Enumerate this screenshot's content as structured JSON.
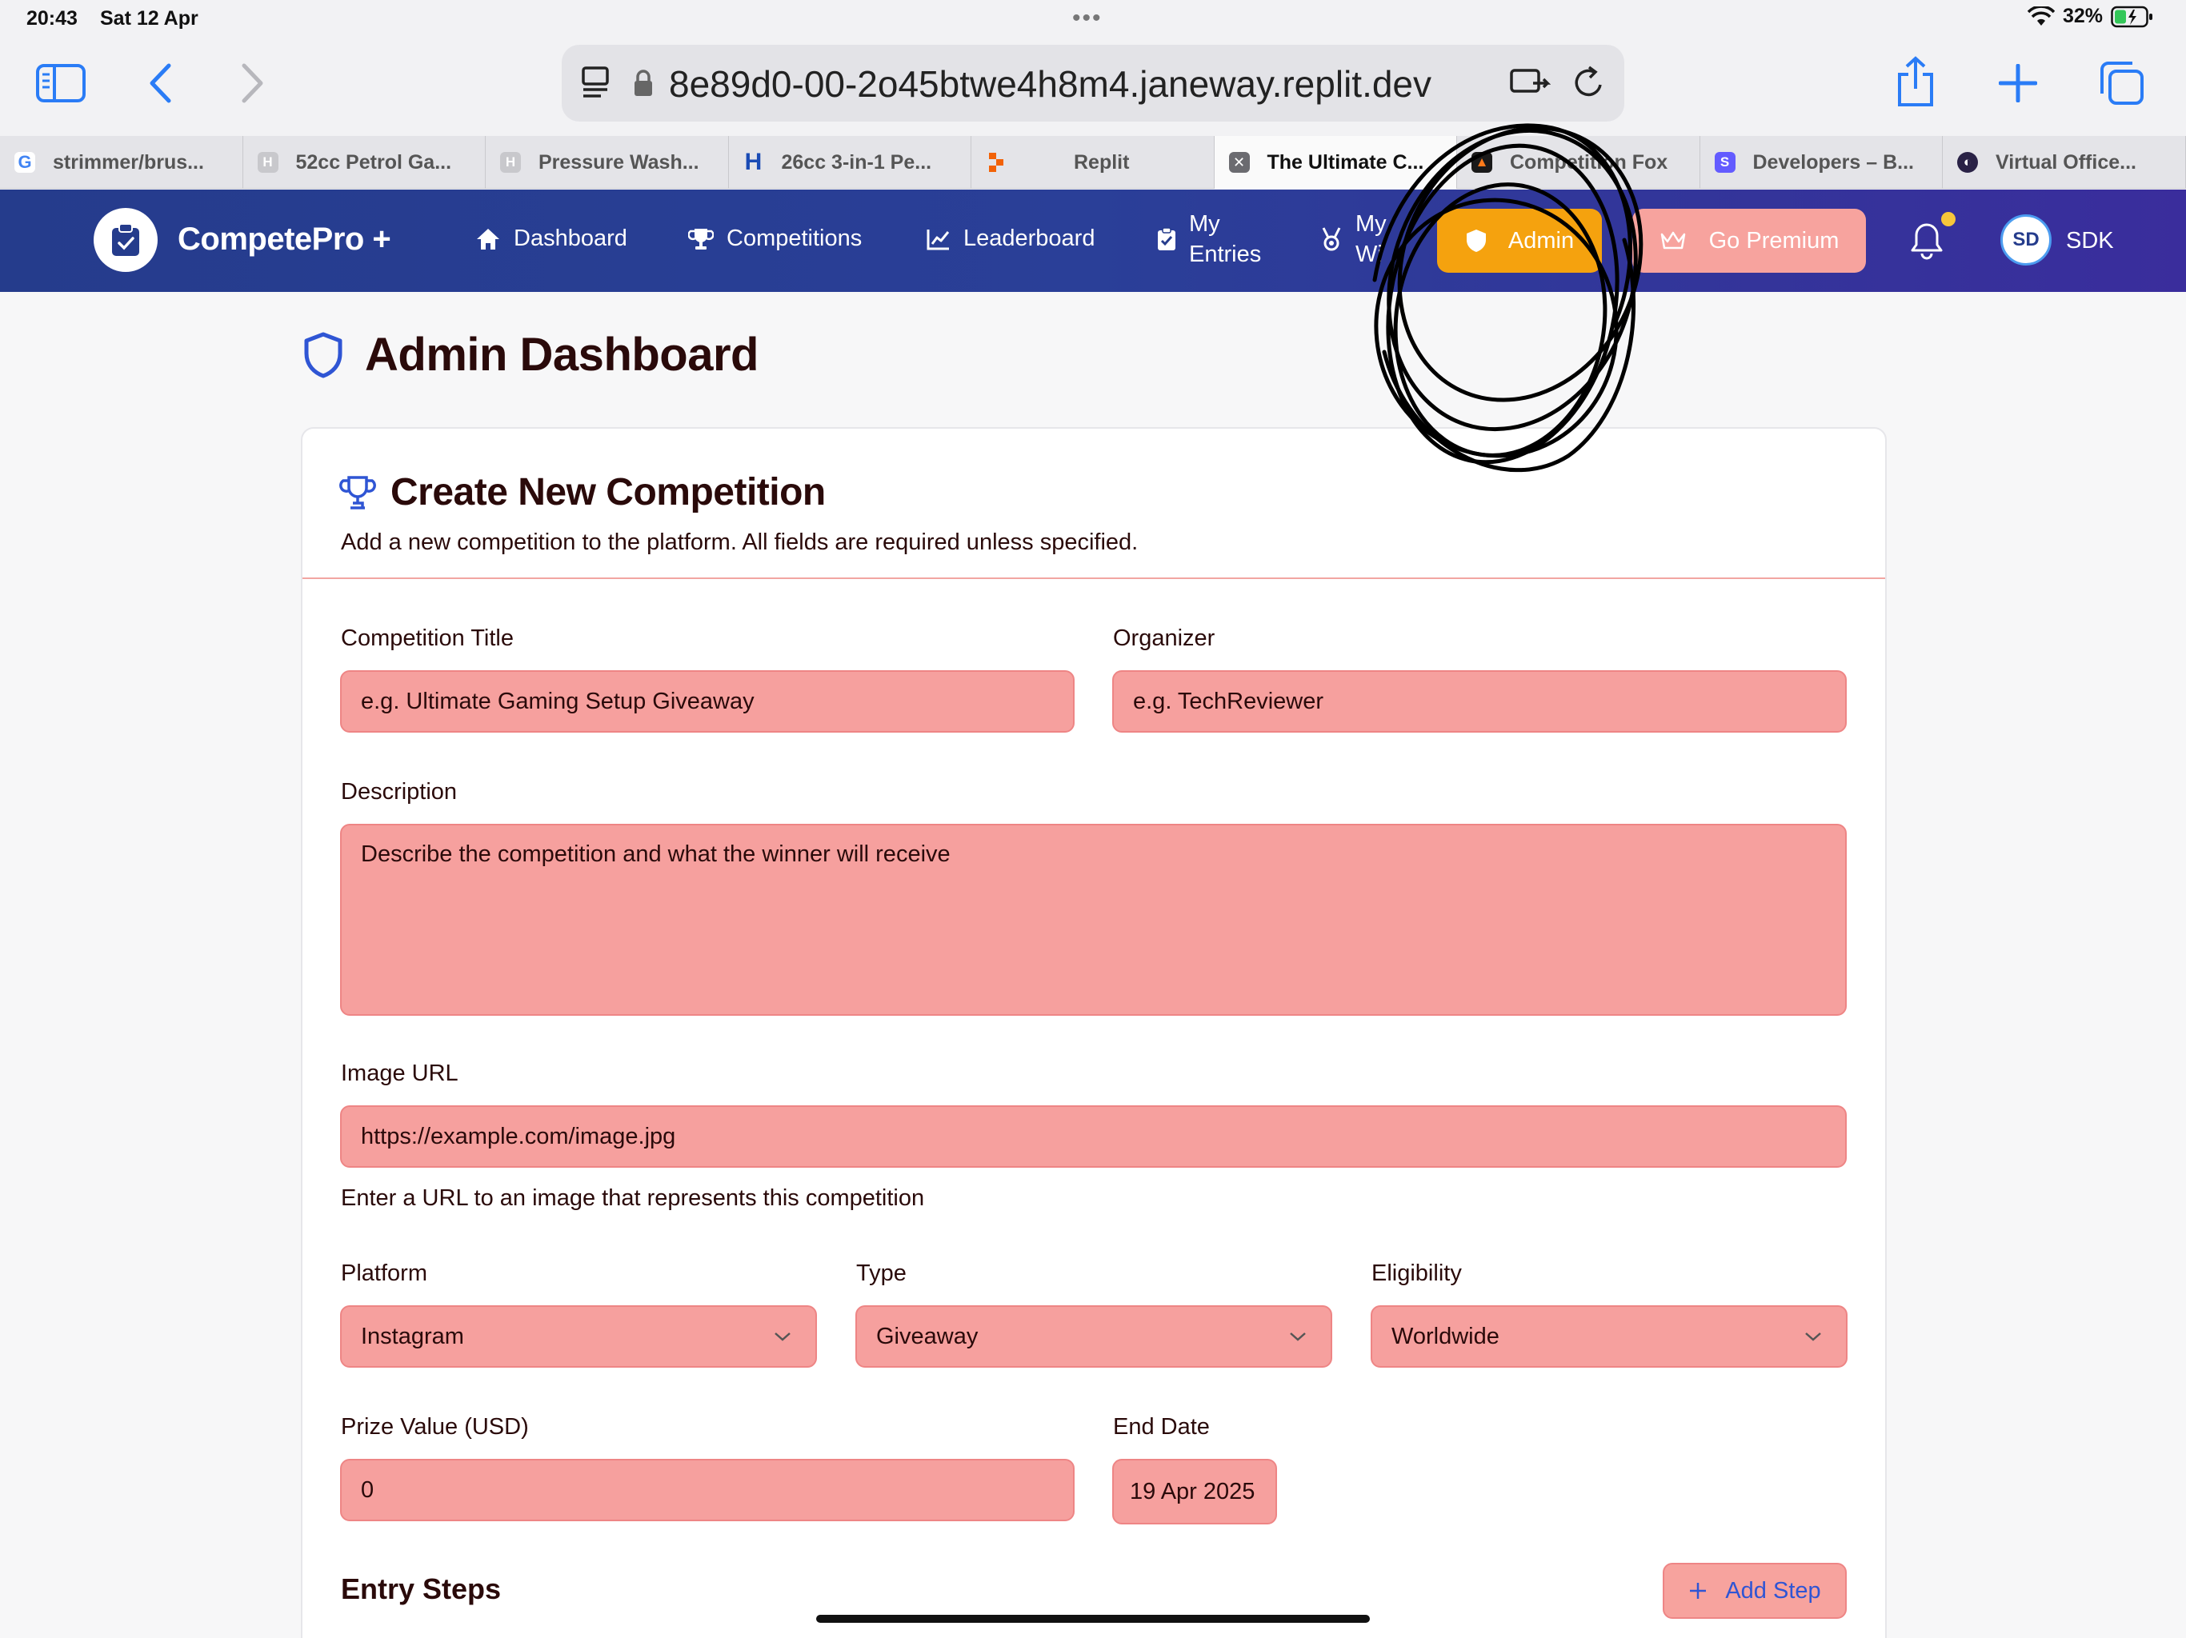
{
  "status_bar": {
    "time": "20:43",
    "date": "Sat 12 Apr",
    "battery": "32%"
  },
  "browser": {
    "url": "8e89d0-00-2o45btwe4h8m4.janeway.replit.dev",
    "tabs": [
      {
        "label": "strimmer/brus...",
        "favicon": "google-icon",
        "active": false
      },
      {
        "label": "52cc Petrol Ga...",
        "favicon": "h-icon",
        "active": false
      },
      {
        "label": "Pressure Wash...",
        "favicon": "h-icon",
        "active": false
      },
      {
        "label": "26cc 3-in-1 Pe...",
        "favicon": "h-brand-icon",
        "active": false
      },
      {
        "label": "Replit",
        "favicon": "replit-icon",
        "active": false
      },
      {
        "label": "The Ultimate C...",
        "favicon": "close-tab-icon",
        "active": true
      },
      {
        "label": "Competition Fox",
        "favicon": "fox-icon",
        "active": false
      },
      {
        "label": "Developers – B...",
        "favicon": "s-icon",
        "active": false
      },
      {
        "label": "Virtual Office...",
        "favicon": "virtual-office-icon",
        "active": false
      }
    ]
  },
  "app_nav": {
    "brand": "CompetePro +",
    "items": [
      {
        "label": "Dashboard",
        "icon": "home-icon"
      },
      {
        "label": "Competitions",
        "icon": "trophy-icon"
      },
      {
        "label": "Leaderboard",
        "icon": "chart-line-icon"
      },
      {
        "label": "My Entries",
        "line1": "My",
        "line2": "Entries",
        "icon": "clipboard-check-icon"
      },
      {
        "label": "My Wins",
        "line1": "My",
        "line2": "Wi",
        "icon": "medal-icon"
      }
    ],
    "admin_label": "Admin",
    "premium_label": "Go Premium",
    "user_initials": "SD",
    "user_name": "SDK",
    "colors": {
      "nav_start": "#253c8c",
      "nav_end": "#3a2d9c",
      "admin": "#f5a20e",
      "premium": "#f7a39e"
    }
  },
  "page": {
    "title": "Admin Dashboard"
  },
  "form": {
    "title": "Create New Competition",
    "subtitle": "Add a new competition to the platform. All fields are required unless specified.",
    "competition_title": {
      "label": "Competition Title",
      "placeholder": "e.g. Ultimate Gaming Setup Giveaway"
    },
    "organizer": {
      "label": "Organizer",
      "placeholder": "e.g. TechReviewer"
    },
    "description": {
      "label": "Description",
      "placeholder": "Describe the competition and what the winner will receive"
    },
    "image_url": {
      "label": "Image URL",
      "placeholder": "https://example.com/image.jpg",
      "hint": "Enter a URL to an image that represents this competition"
    },
    "platform": {
      "label": "Platform",
      "value": "Instagram"
    },
    "type": {
      "label": "Type",
      "value": "Giveaway"
    },
    "eligibility": {
      "label": "Eligibility",
      "value": "Worldwide"
    },
    "prize_value": {
      "label": "Prize Value (USD)",
      "value": "0"
    },
    "end_date": {
      "label": "End Date",
      "value": "19 Apr 2025"
    },
    "entry_steps": {
      "title": "Entry Steps",
      "add_label": "Add Step"
    },
    "field_color": "#f6a09e"
  }
}
